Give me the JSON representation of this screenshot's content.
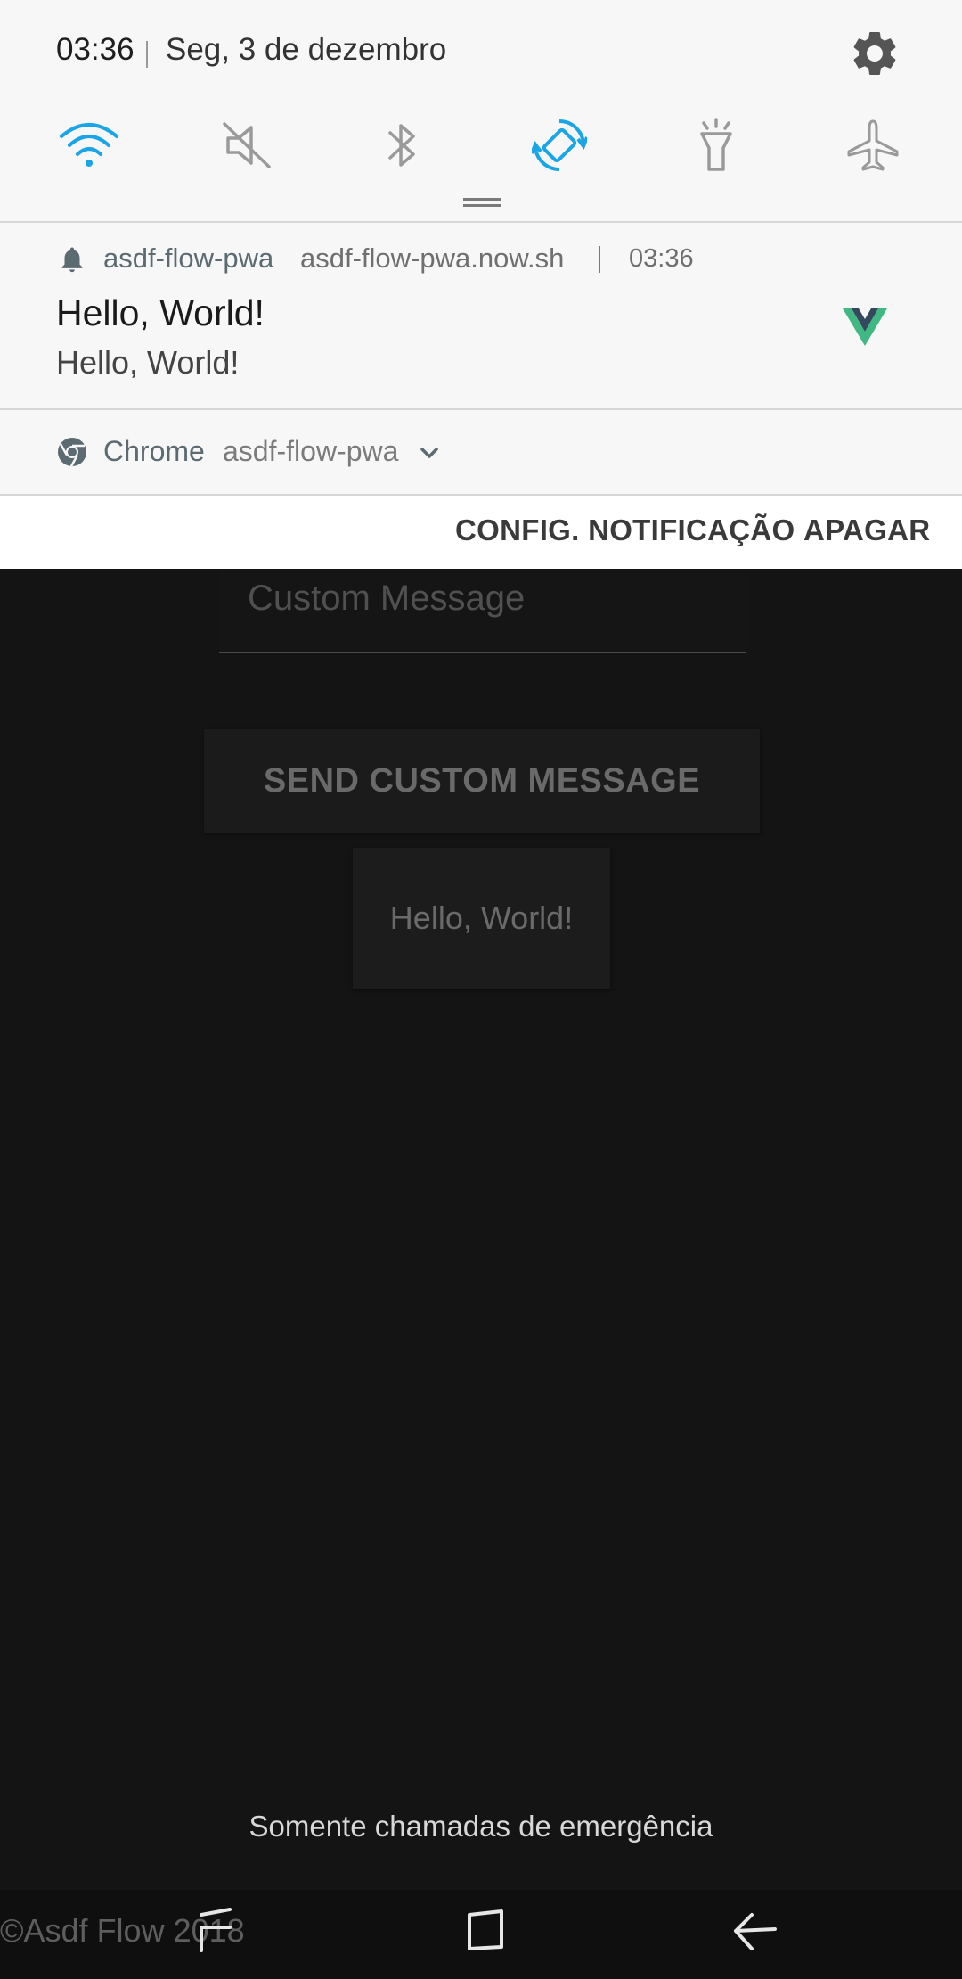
{
  "status_bar": {
    "time": "03:36",
    "date": "Seg, 3 de dezembro"
  },
  "quick_settings": [
    {
      "icon": "wifi-icon",
      "active": true
    },
    {
      "icon": "sound-mute-icon",
      "active": false
    },
    {
      "icon": "bluetooth-icon",
      "active": false
    },
    {
      "icon": "auto-rotate-icon",
      "active": true
    },
    {
      "icon": "flashlight-icon",
      "active": false
    },
    {
      "icon": "airplane-mode-icon",
      "active": false
    }
  ],
  "colors": {
    "accent": "#1aa5e6",
    "inactive_icon": "#9a9a9a",
    "vue_green": "#41b883",
    "vue_dark": "#35495e"
  },
  "notification": {
    "app_name": "asdf-flow-pwa",
    "host": "asdf-flow-pwa.now.sh",
    "time": "03:36",
    "title": "Hello, World!",
    "body": "Hello, World!"
  },
  "chrome_group": {
    "app_name": "Chrome",
    "site": "asdf-flow-pwa"
  },
  "actions": {
    "settings_label": "CONFIG. NOTIFICAÇÃO",
    "clear_label": "APAGAR"
  },
  "app": {
    "custom_message_placeholder": "Custom Message",
    "send_button_label": "SEND CUSTOM MESSAGE",
    "hello_card_text": "Hello, World!",
    "footer_text": "©Asdf Flow 2018"
  },
  "lockscreen": {
    "emergency_text": "Somente chamadas de emergência"
  }
}
